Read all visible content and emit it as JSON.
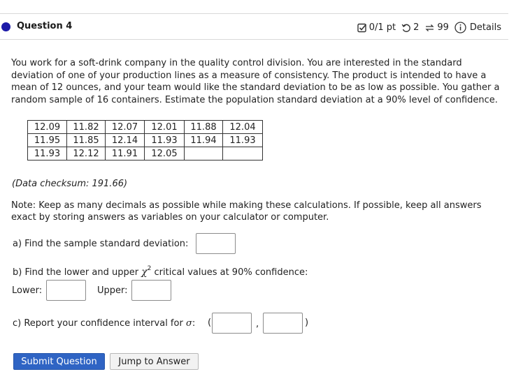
{
  "question": {
    "title": "Question 4",
    "score": "0/1 pt",
    "retries": "2",
    "attempts": "99",
    "details_label": "Details"
  },
  "prompt": {
    "text": "You work for a soft-drink company in the quality control division.  You are interested in the standard deviation of one of your production lines as a measure of consistency. The product is intended to have a mean of 12 ounces, and your team would like the standard deviation to be as low as possible.  You gather a random sample of 16 containers.  Estimate the population standard deviation at a 90% level of confidence."
  },
  "data_table": {
    "rows": [
      [
        "12.09",
        "11.82",
        "12.07",
        "12.01",
        "11.88",
        "12.04"
      ],
      [
        "11.95",
        "11.85",
        "12.14",
        "11.93",
        "11.94",
        "11.93"
      ],
      [
        "11.93",
        "12.12",
        "11.91",
        "12.05",
        "",
        ""
      ]
    ]
  },
  "checksum": "(Data checksum: 191.66)",
  "note": "Note: Keep as many decimals as  possible while making these calculations. If possible, keep all answers exact by storing answers as variables on your calculator or computer.",
  "part_a": {
    "label": "a) Find the sample standard deviation:",
    "value": ""
  },
  "part_b": {
    "label_before": "b) Find the lower and upper ",
    "chi": "χ",
    "sup": "2",
    "label_after": " critical values at 90% confidence:",
    "lower_label": "Lower:",
    "upper_label": "Upper:",
    "lower_value": "",
    "upper_value": ""
  },
  "part_c": {
    "label_before": "c) Report your confidence interval for ",
    "sigma": "σ",
    "label_after": ":",
    "open_paren": "(",
    "comma": ",",
    "close_paren": ")",
    "low_value": "",
    "high_value": ""
  },
  "buttons": {
    "submit": "Submit Question",
    "jump": "Jump to Answer"
  },
  "colors": {
    "accent": "#1c1aa8",
    "primary_button": "#2f64c4"
  }
}
